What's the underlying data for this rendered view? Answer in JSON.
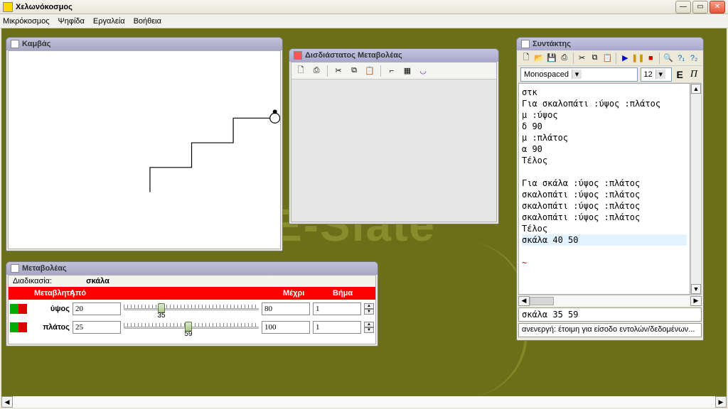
{
  "app": {
    "title": "Χελωνόκοσμος"
  },
  "menu": {
    "items": [
      "Μικρόκοσμος",
      "Ψηφίδα",
      "Εργαλεία",
      "Βοήθεια"
    ]
  },
  "canvas": {
    "title": "Καμβάς"
  },
  "var2d": {
    "title": "Δισδιάστατος Μεταβολέας"
  },
  "variator": {
    "title": "Μεταβολέας",
    "procedure_label": "Διαδικασία:",
    "procedure_name": "σκάλα",
    "headers": {
      "variable": "Μεταβλητή",
      "from": "Από",
      "to": "Μέχρι",
      "step": "Βήμα"
    },
    "rows": [
      {
        "name": "ύψος",
        "from": "20",
        "to": "80",
        "step": "1",
        "slider_label": "35",
        "thumb_pct": 25
      },
      {
        "name": "πλάτος",
        "from": "25",
        "to": "100",
        "step": "1",
        "slider_label": "59",
        "thumb_pct": 45
      }
    ]
  },
  "editor": {
    "title": "Συντάκτης",
    "font": "Monospaced",
    "size": "12",
    "bold": "E",
    "italic": "Π",
    "code_lines": [
      "στκ",
      "Για σκαλοπάτι :ύψος :πλάτος",
      "μ :ύψος",
      "δ 90",
      "μ :πλάτος",
      "α 90",
      "Τέλος",
      "",
      "Για σκάλα :ύψος :πλάτος",
      "σκαλοπάτι :ύψος :πλάτος",
      "σκαλοπάτι :ύψος :πλάτος",
      "σκαλοπάτι :ύψος :πλάτος",
      "Τέλος",
      "σκάλα 40 50",
      "",
      "~"
    ],
    "highlight_line": 13,
    "command": "σκάλα 35 59",
    "status": "ανενεργή: έτοιμη για είσοδο εντολών/δεδομένων..."
  },
  "watermark": "E-Slate"
}
